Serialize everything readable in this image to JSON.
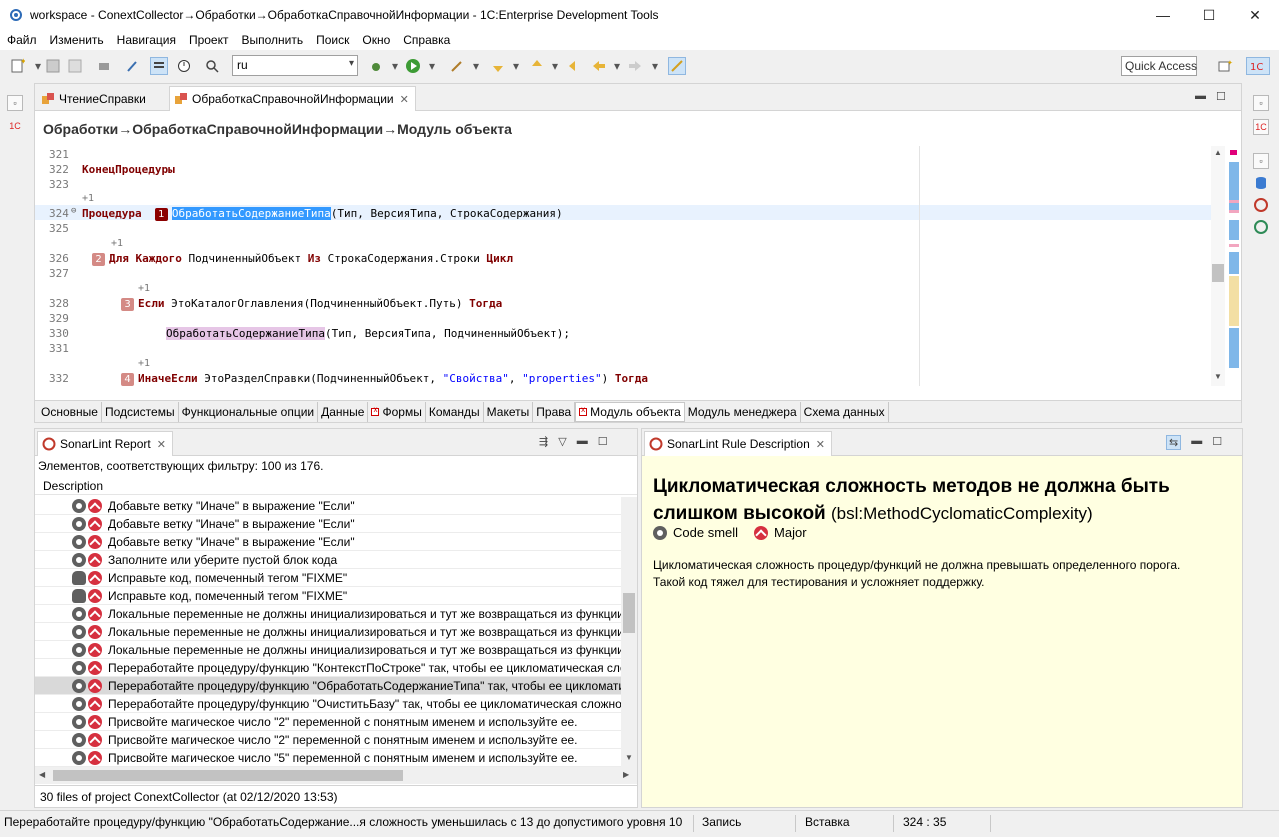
{
  "window": {
    "title": "workspace - ConextCollector→Обработки→ОбработкаСправочнойИнформации - 1C:Enterprise Development Tools",
    "minimize": "—",
    "maximize": "☐",
    "close": "✕"
  },
  "menu": [
    "Файл",
    "Изменить",
    "Навигация",
    "Проект",
    "Выполнить",
    "Поиск",
    "Окно",
    "Справка"
  ],
  "toolbar": {
    "combo_value": "ru",
    "quick_access": "Quick Access"
  },
  "editor": {
    "tabs": [
      {
        "label": "ЧтениеСправки"
      },
      {
        "label": "ОбработкаСправочнойИнформации"
      }
    ],
    "breadcrumb": "Обработки→ОбработкаСправочнойИнформации→Модуль объекта",
    "lines": {
      "l321": "321",
      "l322": "322",
      "l322_text": "КонецПроцедуры",
      "l323": "323",
      "l324": "324",
      "l324_kw": "Процедура",
      "l324_badge": "1",
      "l324_name": "ОбработатьСодержаниеТипа",
      "l324_rest": "(Тип, ВерсияТипа, СтрокаСодержания)",
      "l325": "325",
      "l326": "326",
      "l326_badge": "2",
      "l326_kw1": "Для Каждого",
      "l326_mid": " ПодчиненныйОбъект ",
      "l326_kw2": "Из",
      "l326_mid2": " СтрокаСодержания.Строки ",
      "l326_kw3": "Цикл",
      "l327": "327",
      "l328": "328",
      "l328_badge": "3",
      "l328_kw1": "Если",
      "l328_fn": " ЭтоКаталогОглавления",
      "l328_mid": "(ПодчиненныйОбъект.Путь) ",
      "l328_kw2": "Тогда",
      "l329": "329",
      "l330": "330",
      "l330_fn": "ОбработатьСодержаниеТипа",
      "l330_rest": "(Тип, ВерсияТипа, ПодчиненныйОбъект);",
      "l331": "331",
      "l332": "332",
      "l332_badge": "4",
      "l332_kw1": "ИначеЕсли",
      "l332_fn": " ЭтоРазделСправки",
      "l332_mid": "(ПодчиненныйОбъект, ",
      "l332_s1": "\"Свойства\"",
      "l332_comma": ", ",
      "l332_s2": "\"properties\"",
      "l332_end": ") ",
      "l332_kw2": "Тогда",
      "plus": "+1"
    },
    "bottom_tabs": [
      {
        "label": "Основные"
      },
      {
        "label": "Подсистемы"
      },
      {
        "label": "Функциональные опции"
      },
      {
        "label": "Данные"
      },
      {
        "label": "Формы"
      },
      {
        "label": "Команды"
      },
      {
        "label": "Макеты"
      },
      {
        "label": "Права"
      },
      {
        "label": "Модуль объекта"
      },
      {
        "label": "Модуль менеджера"
      },
      {
        "label": "Схема данных"
      }
    ]
  },
  "report": {
    "tab_label": "SonarLint Report",
    "filter_text": "Элементов, соответствующих фильтру: 100 из 176.",
    "column_header": "Description",
    "rows": [
      {
        "text": "Добавьте ветку \"Иначе\" в выражение \"Если\""
      },
      {
        "text": "Добавьте ветку \"Иначе\" в выражение \"Если\""
      },
      {
        "text": "Добавьте ветку \"Иначе\" в выражение \"Если\""
      },
      {
        "text": "Заполните или уберите пустой блок кода"
      },
      {
        "text": "Исправьте код, помеченный тегом \"FIXME\""
      },
      {
        "text": "Исправьте код, помеченный тегом \"FIXME\""
      },
      {
        "text": "Локальные переменные не должны инициализироваться и тут же возвращаться из функции"
      },
      {
        "text": "Локальные переменные не должны инициализироваться и тут же возвращаться из функции"
      },
      {
        "text": "Локальные переменные не должны инициализироваться и тут же возвращаться из функции"
      },
      {
        "text": "Переработайте процедуру/функцию \"КонтекстПоСтроке\" так, чтобы ее цикломатическая сложность"
      },
      {
        "text": "Переработайте процедуру/функцию \"ОбработатьСодержаниеТипа\" так, чтобы ее цикломатическая"
      },
      {
        "text": "Переработайте процедуру/функцию \"ОчиститьБазу\" так, чтобы ее цикломатическая сложность"
      },
      {
        "text": "Присвойте магическое число \"2\" переменной с понятным именем и используйте ее."
      },
      {
        "text": "Присвойте магическое число \"2\" переменной с понятным именем и используйте ее."
      },
      {
        "text": "Присвойте магическое число \"5\" переменной с понятным именем и используйте ее."
      }
    ],
    "footer": "30 files of project ConextCollector (at 02/12/2020 13:53)"
  },
  "rule": {
    "tab_label": "SonarLint Rule Description",
    "title": "Цикломатическая сложность методов не должна быть слишком высокой",
    "key": "(bsl:MethodCyclomaticComplexity)",
    "type": "Code smell",
    "severity": "Major",
    "description": "Цикломатическая сложность процедур/функций не должна превышать определенного порога. Такой код тяжел для тестирования и усложняет поддержку."
  },
  "status": {
    "message": "Переработайте процедуру/функцию \"ОбработатьСодержание...я сложность уменьшилась с 13 до допустимого уровня 10",
    "mode": "Запись",
    "insert": "Вставка",
    "position": "324 : 35"
  }
}
